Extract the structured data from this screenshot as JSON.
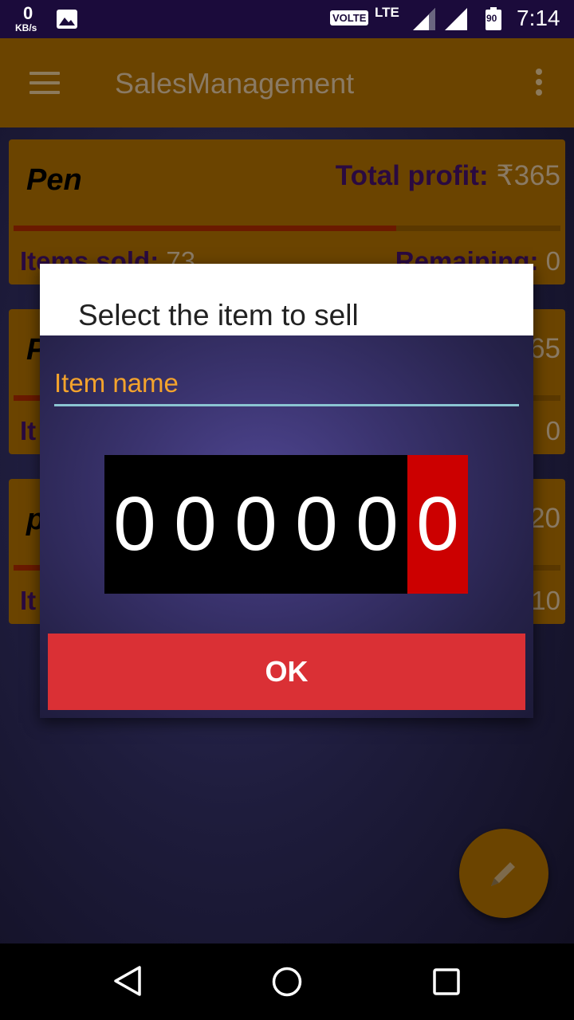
{
  "status_bar": {
    "net_speed_value": "0",
    "net_speed_unit": "KB/s",
    "volte_label": "VOLTE",
    "network_type": "LTE",
    "battery_level": "90",
    "time": "7:14"
  },
  "app_bar": {
    "title": "SalesManagement"
  },
  "cards": [
    {
      "name": "Pen",
      "profit_label": "Total profit: ",
      "profit_value": "₹365",
      "progress": 0.7,
      "sold_label": "Items sold: ",
      "sold_value": "73",
      "remaining_label": "Remaining: ",
      "remaining_value": "0"
    },
    {
      "name": "P",
      "profit_value": "65",
      "remaining_value": "0",
      "progress": 0.7,
      "sold_label": "It"
    },
    {
      "name": "p",
      "profit_value": "20",
      "remaining_value": "10",
      "progress": 0.8,
      "sold_label": "It"
    }
  ],
  "dialog": {
    "title": "Select the item to sell",
    "item_name_placeholder": "Item name",
    "digits": [
      "0",
      "0",
      "0",
      "0",
      "0",
      "0"
    ],
    "active_digit_index": 5,
    "ok_label": "OK"
  },
  "fab": {
    "icon": "pencil-icon"
  },
  "colors": {
    "app_bar": "#6b4400",
    "status_bar": "#1b0b3b",
    "ok_button": "#da3035",
    "active_digit": "#cc0000",
    "input_text": "#f4a32c"
  }
}
